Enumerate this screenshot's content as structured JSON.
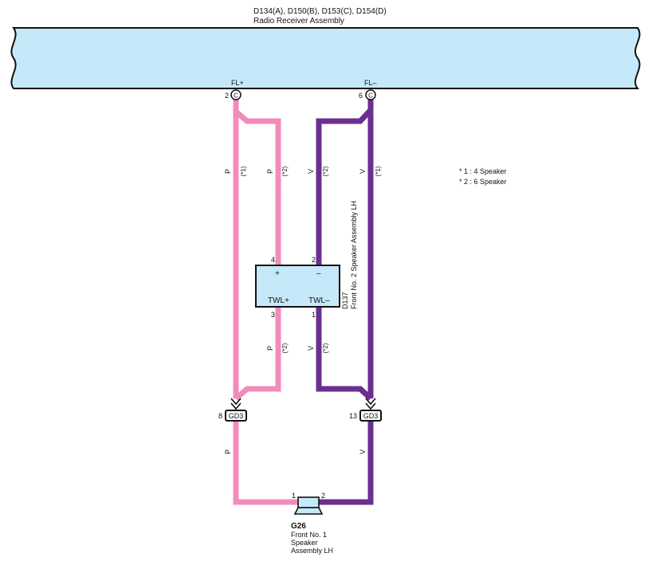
{
  "header": {
    "connector_ids": "D134(A), D150(B), D153(C), D154(D)",
    "assembly_name": "Radio Receiver Assembly"
  },
  "radio_pins": {
    "fl_plus": {
      "label": "FL+",
      "pin": "2",
      "connector": "C"
    },
    "fl_minus": {
      "label": "FL–",
      "pin": "6",
      "connector": "C"
    }
  },
  "wire_labels": {
    "p": "P",
    "v": "V",
    "star1": "(*1)",
    "star2": "(*2)"
  },
  "notes": [
    "* 1 : 4 Speaker",
    "* 2 : 6 Speaker"
  ],
  "tweeter": {
    "id": "D137",
    "name": "Front No. 2 Speaker Assembly LH",
    "plus_symbol": "+",
    "minus_symbol": "–",
    "twl_plus": "TWL+",
    "twl_minus": "TWL–",
    "pin_top_left": "4",
    "pin_top_right": "2",
    "pin_bottom_left": "3",
    "pin_bottom_right": "1"
  },
  "junctions": {
    "left": {
      "pin": "8",
      "label": "GD3"
    },
    "right": {
      "pin": "13",
      "label": "GD3"
    }
  },
  "speaker": {
    "id": "G26",
    "line1": "Front No. 1",
    "line2": "Speaker",
    "line3": "Assembly LH",
    "pin_left": "1",
    "pin_right": "2"
  },
  "colors": {
    "pink_wire": "#f08cba",
    "violet_wire": "#6b2f8f",
    "component_fill": "#c6e9f9"
  }
}
